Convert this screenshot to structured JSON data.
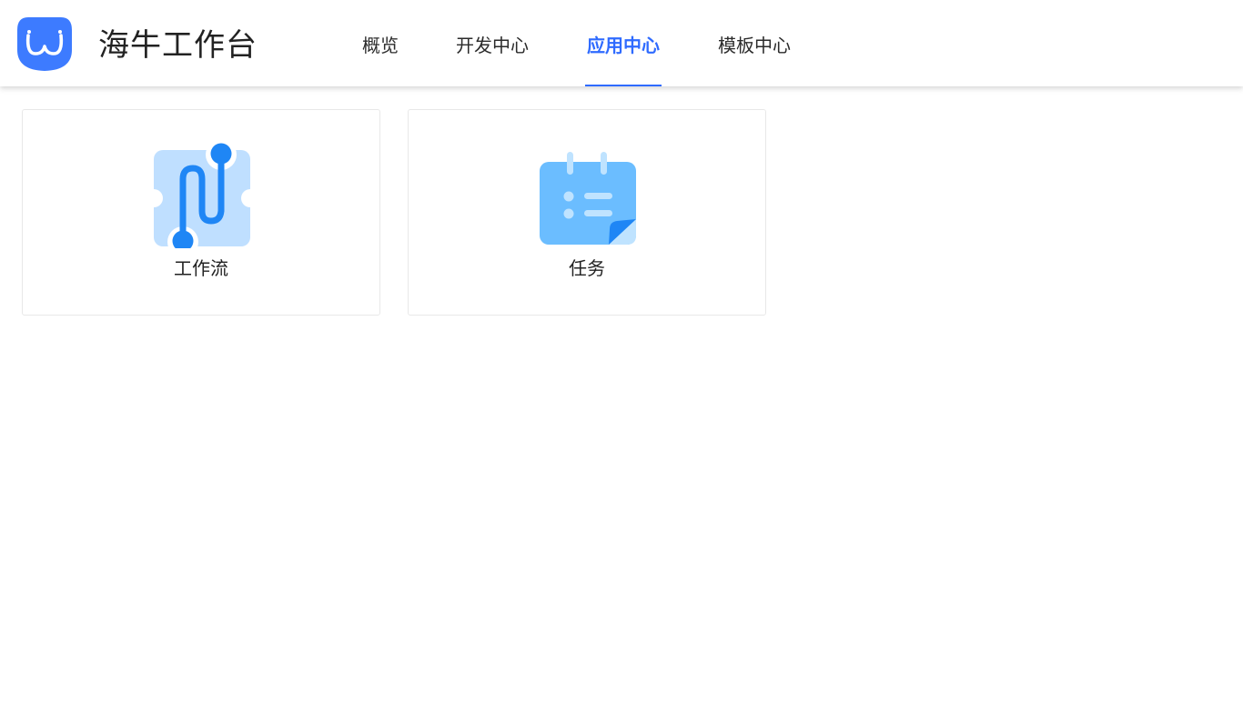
{
  "header": {
    "title": "海牛工作台",
    "logo_icon": "smile-logo-icon",
    "brand_color": "#3d7bff"
  },
  "nav": {
    "tabs": [
      {
        "label": "概览",
        "active": false
      },
      {
        "label": "开发中心",
        "active": false
      },
      {
        "label": "应用中心",
        "active": true
      },
      {
        "label": "模板中心",
        "active": false
      }
    ],
    "active_color": "#2f6bff"
  },
  "apps": [
    {
      "label": "工作流",
      "icon": "workflow-icon"
    },
    {
      "label": "任务",
      "icon": "task-calendar-icon"
    }
  ]
}
